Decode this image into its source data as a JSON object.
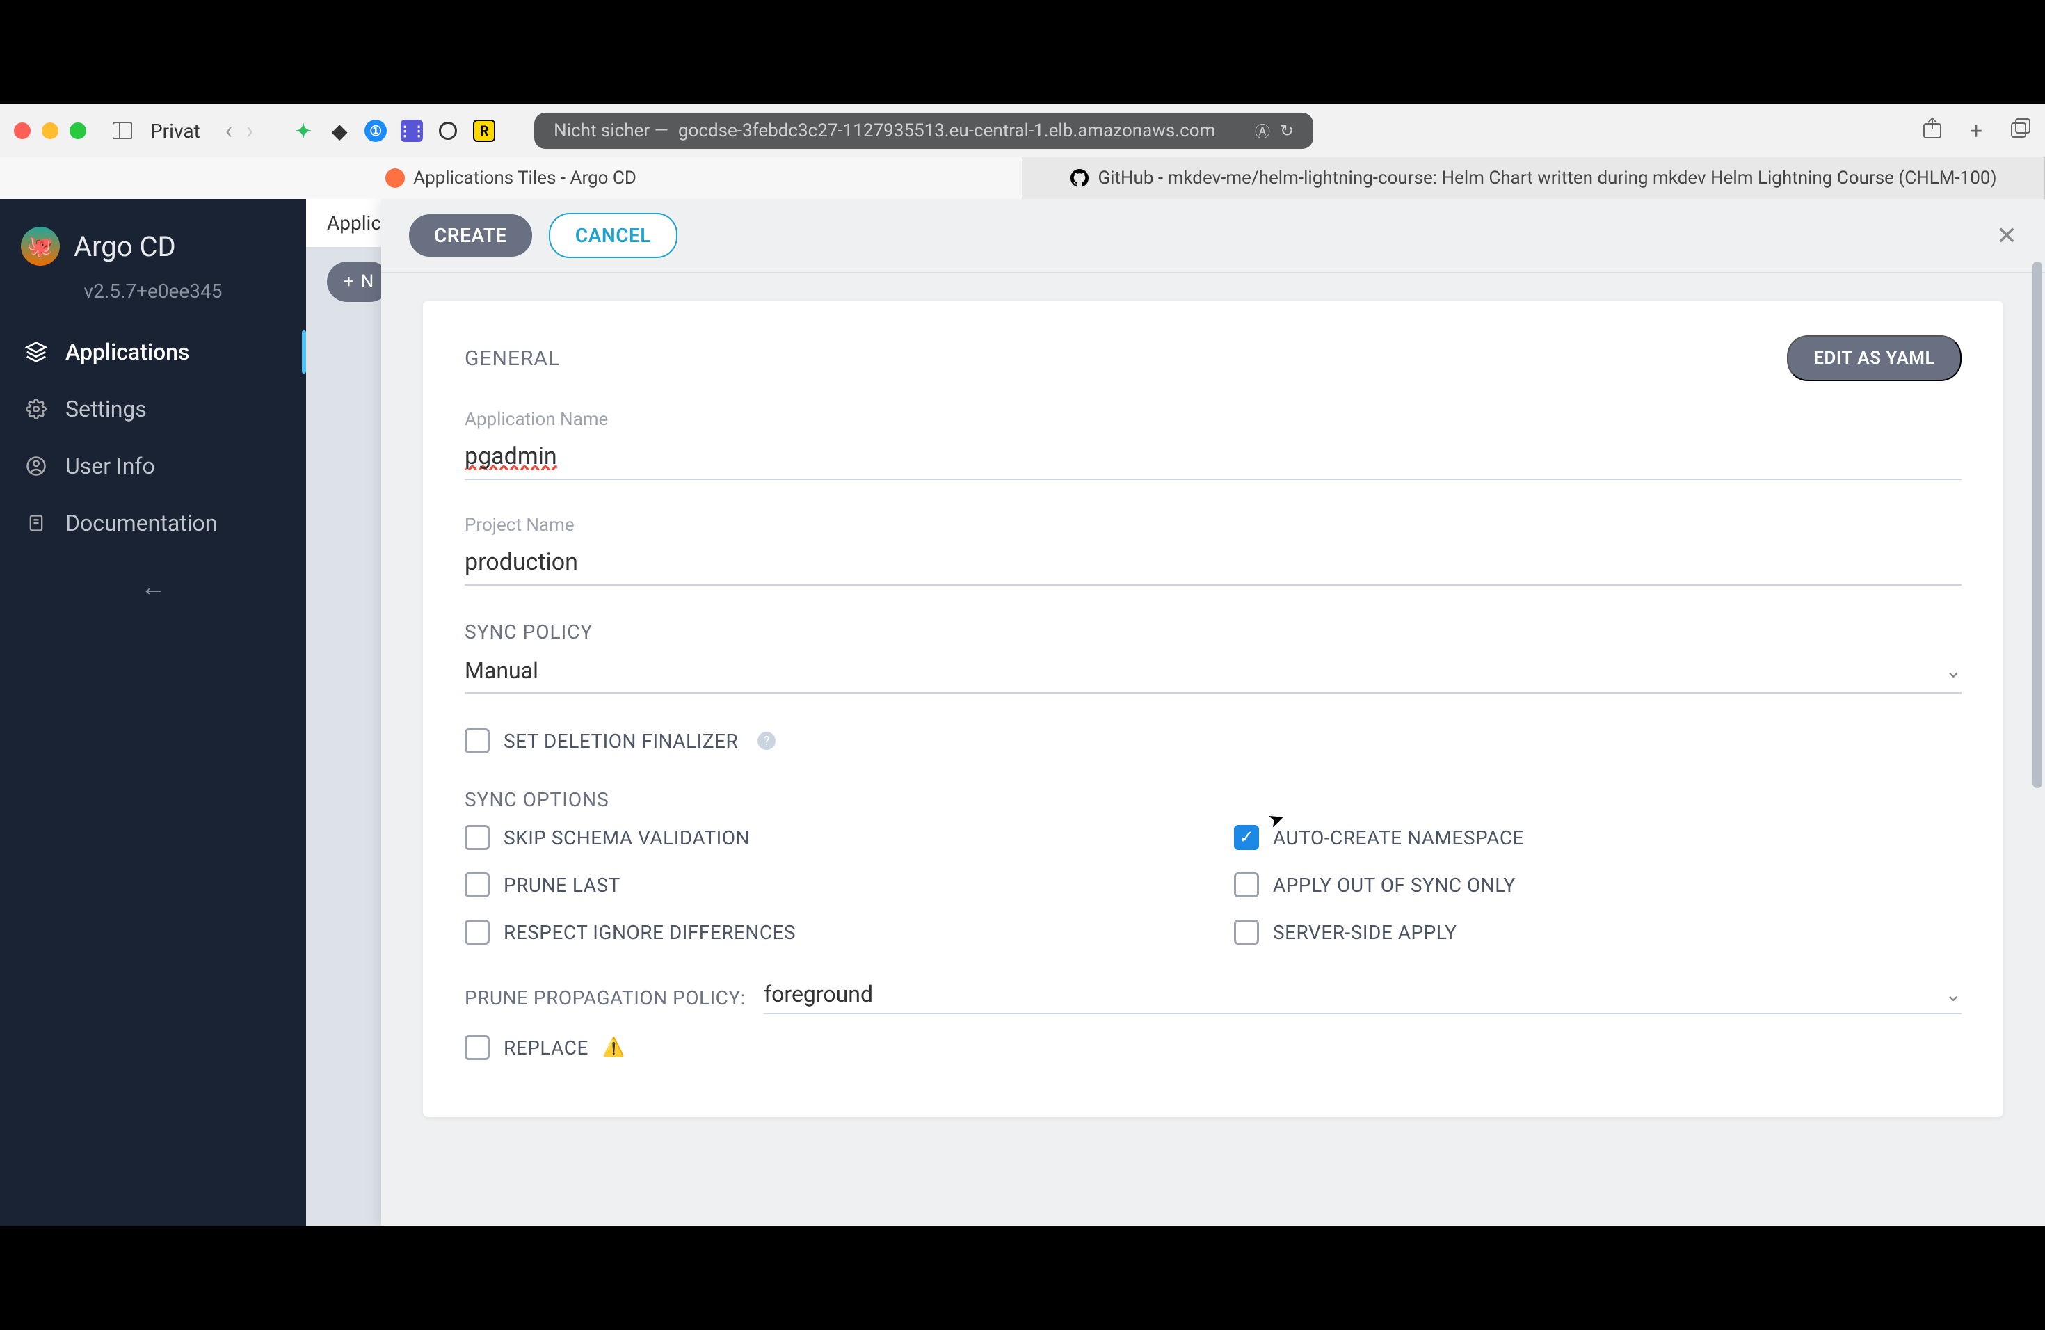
{
  "browser": {
    "privat_label": "Privat",
    "address_prefix": "Nicht sicher —",
    "address_host": "gocdse-3febdc3c27-1127935513.eu-central-1.elb.amazonaws.com",
    "tabs": [
      {
        "label": "Applications Tiles - Argo CD"
      },
      {
        "label": "GitHub - mkdev-me/helm-lightning-course: Helm Chart written during mkdev Helm Lightning Course (CHLM-100)"
      }
    ]
  },
  "sidebar": {
    "title": "Argo CD",
    "version": "v2.5.7+e0ee345",
    "items": [
      {
        "label": "Applications"
      },
      {
        "label": "Settings"
      },
      {
        "label": "User Info"
      },
      {
        "label": "Documentation"
      }
    ]
  },
  "bg": {
    "breadcrumb": "Applica",
    "new_label": "N"
  },
  "panel": {
    "create_label": "CREATE",
    "cancel_label": "CANCEL",
    "section_general": "GENERAL",
    "edit_yaml": "EDIT AS YAML",
    "fields": {
      "app_name_label": "Application Name",
      "app_name_value": "pgadmin",
      "project_label": "Project Name",
      "project_value": "production"
    },
    "sync_policy": {
      "title": "SYNC POLICY",
      "value": "Manual"
    },
    "deletion_finalizer": "SET DELETION FINALIZER",
    "sync_options": {
      "title": "SYNC OPTIONS",
      "skip_schema": "SKIP SCHEMA VALIDATION",
      "auto_create_ns": "AUTO-CREATE NAMESPACE",
      "prune_last": "PRUNE LAST",
      "apply_oos": "APPLY OUT OF SYNC ONLY",
      "respect_ignore": "RESPECT IGNORE DIFFERENCES",
      "server_side": "SERVER-SIDE APPLY"
    },
    "prune_policy": {
      "label": "PRUNE PROPAGATION POLICY:",
      "value": "foreground"
    },
    "replace": "REPLACE"
  }
}
